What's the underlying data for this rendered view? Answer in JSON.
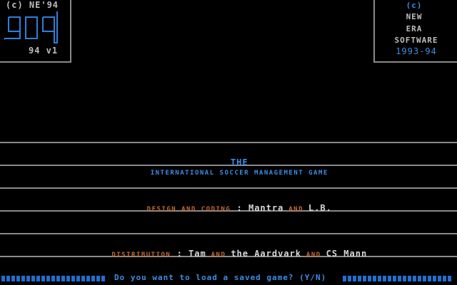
{
  "logo_box": {
    "copyright": "(c) NE'94",
    "logo_text": "909",
    "version": "94 v1"
  },
  "publisher_box": {
    "c": "(c)",
    "new": "NEW",
    "era": "ERA",
    "software": "SOFTWARE",
    "years": "1993-94"
  },
  "title_line": {
    "the": "THE",
    "rest": "INTERNATIONAL SOCCER MANAGEMENT GAME"
  },
  "design_line": {
    "label": "DESIGN AND CODING",
    "sep": " : ",
    "name1": "Mantra",
    "and": " AND ",
    "name2": "L.B."
  },
  "distribution_line": {
    "label": "DISTRIBUTION",
    "sep": " : ",
    "name1": "Tam",
    "and1": " AND ",
    "name2": "the Aardvark",
    "and2": " AND ",
    "name3": "CS Mann"
  },
  "prompt": {
    "text": "Do you want to load a saved game? (Y/N)"
  },
  "colors": {
    "blue": "#3a8ee6",
    "orange": "#c8682e",
    "grey": "#bdbdbd"
  }
}
